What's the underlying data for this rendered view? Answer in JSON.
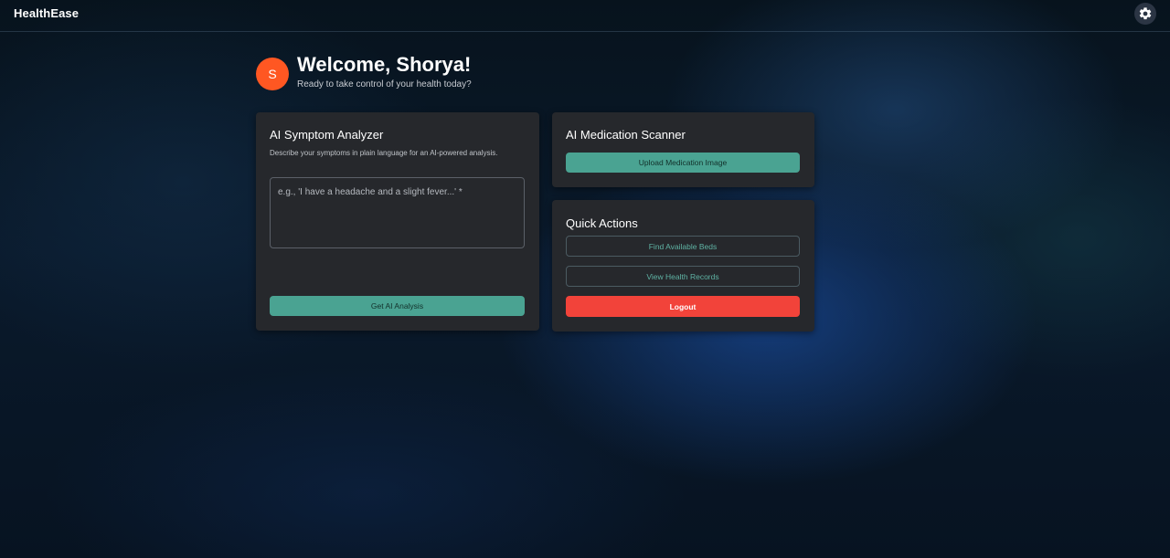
{
  "app": {
    "brand": "HealthEase",
    "settings_icon": "gear-icon"
  },
  "welcome": {
    "avatar_initial": "S",
    "title": "Welcome, Shorya!",
    "subtitle": "Ready to take control of your health today?"
  },
  "symptom_analyzer": {
    "title": "AI Symptom Analyzer",
    "description": "Describe your symptoms in plain language for an AI-powered analysis.",
    "input_value": "",
    "input_placeholder": "e.g., 'I have a headache and a slight fever...' *",
    "submit_label": "Get AI Analysis"
  },
  "medication_scanner": {
    "title": "AI Medication Scanner",
    "upload_label": "Upload Medication Image"
  },
  "quick_actions": {
    "title": "Quick Actions",
    "find_beds_label": "Find Available Beds",
    "health_records_label": "View Health Records",
    "logout_label": "Logout"
  },
  "colors": {
    "accent": "#4aa392",
    "danger": "#f2433a",
    "avatar": "#ff5722",
    "card": "#26282c"
  }
}
